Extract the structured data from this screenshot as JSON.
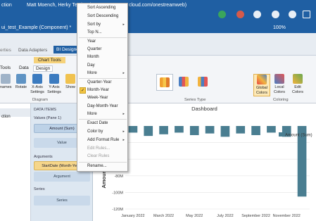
{
  "titlebar": {
    "app_fragment": "ction",
    "user_info": "Matt Moench, Herky Testing (",
    "url_fragment": "cloud.com/onestreamweb)"
  },
  "tabbar": {
    "doc_tab": "ui_test_Example (Component) *",
    "zoom": "100%"
  },
  "tabs": {
    "properties": "erties",
    "data_adapters": "Data Adapters",
    "bi_designer": "BI Designer"
  },
  "ribbon": {
    "context": "Chart Tools",
    "tools": "Tools",
    "data": "Data",
    "design": "Design",
    "btn_names": "names",
    "rotate": "Rotate",
    "x_axis": "X-Axis Settings",
    "y_axis": "Y-Axis Settings",
    "show": "Show",
    "global_colors": "Global Colors",
    "local_colors": "Local Colors",
    "edit_colors": "Edit Colors",
    "diagram": "Diagram",
    "series_type": "Series Type",
    "coloring": "Coloring"
  },
  "left": {
    "label": "ction"
  },
  "items": {
    "header": "DATA ITEMS",
    "values_label": "Values (Pane 1)",
    "amount": "Amount (Sum)",
    "value_drop": "Value",
    "arguments": "Arguments",
    "start_date": "StartDate (Month-Yea...",
    "argument_drop": "Argument",
    "series": "Series",
    "series_drop": "Series"
  },
  "dashboard": {
    "title": "Dashboard"
  },
  "menu": {
    "items": [
      "Sort Ascending",
      "Sort Descending",
      "Sort by",
      "Top N...",
      "Year",
      "Quarter",
      "Month",
      "Day",
      "More",
      "Quarter-Year",
      "Month-Year",
      "Week-Year",
      "Day-Month-Year",
      "More",
      "Exact Date",
      "Color by",
      "Add Format Rule",
      "Edit Rules...",
      "Clear Rules",
      "Rename..."
    ],
    "checked": "Month-Year"
  },
  "colors": {
    "title": "#1f5fa3",
    "bar": "#4a7e91",
    "menu_check": "#f4c542"
  },
  "chart_data": {
    "type": "bar",
    "legend": "Amount (Sum)",
    "ylabel": "Amount ($",
    "y_ticks": [
      "-40M",
      "-60M",
      "-80M",
      "-100M",
      "-120M"
    ],
    "x_ticks": [
      "January 2022",
      "March 2022",
      "May 2022",
      "July 2022",
      "September 2022",
      "November 2022"
    ],
    "ylim": [
      -120,
      -20
    ],
    "values": [
      -28,
      -32,
      -30,
      -28,
      -31,
      -29,
      -33,
      -29,
      -31,
      -28,
      -33,
      -105
    ]
  }
}
